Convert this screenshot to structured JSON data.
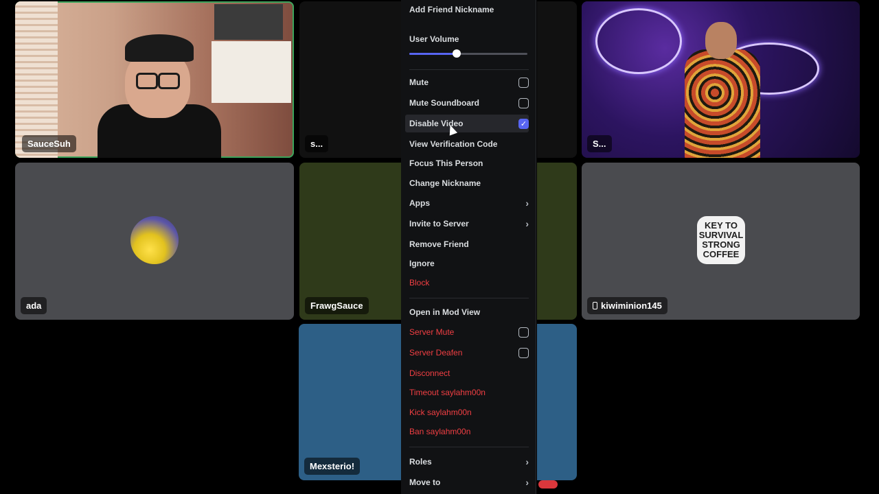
{
  "tiles": [
    {
      "label": "SauceSuh"
    },
    {
      "label": "s..."
    },
    {
      "label": "S..."
    },
    {
      "label": "ada"
    },
    {
      "label": "FrawgSauce"
    },
    {
      "label": "kiwiminion145"
    },
    {
      "label": "Mexsterio!"
    }
  ],
  "sticker_text": [
    "KEY TO",
    "SURVIVAL",
    "STRONG",
    "COFFEE"
  ],
  "menu": {
    "add_friend_nickname": "Add Friend Nickname",
    "user_volume_label": "User Volume",
    "user_volume_fraction": 0.4,
    "mute": {
      "label": "Mute",
      "checked": false
    },
    "mute_soundboard": {
      "label": "Mute Soundboard",
      "checked": false
    },
    "disable_video": {
      "label": "Disable Video",
      "checked": true
    },
    "view_verification_code": "View Verification Code",
    "focus_this_person": "Focus This Person",
    "change_nickname": "Change Nickname",
    "apps": "Apps",
    "invite_to_server": "Invite to Server",
    "remove_friend": "Remove Friend",
    "ignore": "Ignore",
    "block": "Block",
    "open_in_mod_view": "Open in Mod View",
    "server_mute": {
      "label": "Server Mute",
      "checked": false
    },
    "server_deafen": {
      "label": "Server Deafen",
      "checked": false
    },
    "disconnect": "Disconnect",
    "timeout": "Timeout saylahm00n",
    "kick": "Kick saylahm00n",
    "ban": "Ban saylahm00n",
    "roles": "Roles",
    "move_to": "Move to"
  },
  "colors": {
    "accent": "#5865f2",
    "danger": "#f23f43",
    "menu_bg": "#111214",
    "tile_gray": "#4a4b4f",
    "tile_olive": "#2f3a1a",
    "tile_blue": "#2d5f86",
    "speaking": "#3ba55c"
  }
}
